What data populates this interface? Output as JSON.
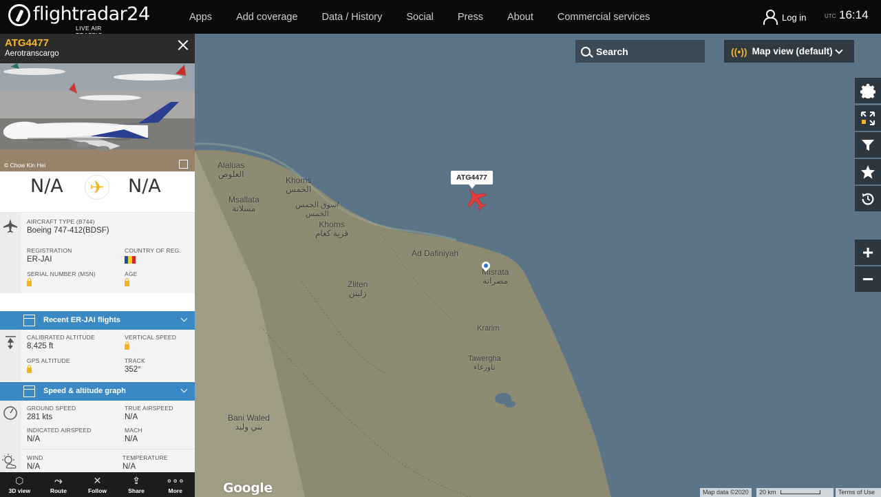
{
  "topbar": {
    "brand": "flightradar24",
    "tagline": "LIVE AIR TRAFFIC",
    "nav": [
      "Apps",
      "Add coverage",
      "Data / History",
      "Social",
      "Press",
      "About",
      "Commercial services"
    ],
    "login_label": "Log in",
    "utc_label": "UTC",
    "time": "16:14"
  },
  "map": {
    "search_label": "Search",
    "map_view_label": "Map view (default)",
    "flight_label": "ATG4477",
    "zoom_in": "+",
    "zoom_out": "−",
    "labels": {
      "alaluas": "Alaluas",
      "alaluas_ar": "العلوص",
      "khoms1": "Khoms",
      "khoms1_ar": "الخمس",
      "msallata": "Msallata",
      "msallata_ar": "مسلاتة",
      "souq_ar": "سوق الخمس/",
      "souq_ar2": "الخمس",
      "khoms2": "Khoms",
      "khoms2_ar": "قرية كعام",
      "dafiniyah": "Ad Dafiniyah",
      "zliten": "Zliten",
      "zliten_ar": "زليتن",
      "misrata": "Misrata",
      "misrata_ar": "مصراتة",
      "krarim": "Krarim",
      "tawergha": "Tawergha",
      "tawergha_ar": "تاورغاء",
      "baniwaled": "Bani Waled",
      "baniwaled_ar": "بني وليد"
    },
    "google": "Google",
    "map_data": "Map data ©2020",
    "scale": "20 km",
    "terms": "Terms of Use"
  },
  "panel": {
    "callsign": "ATG4477",
    "airline": "Aerotranscargo",
    "photo_credit": "© Chow Kin Hei",
    "origin": "N/A",
    "destination": "N/A",
    "aircraft_type_label": "AIRCRAFT TYPE",
    "aircraft_type_code": "(B744)",
    "aircraft_type": "Boeing 747-412(BDSF)",
    "registration_label": "REGISTRATION",
    "registration": "ER-JAI",
    "country_label": "COUNTRY OF REG.",
    "serial_label": "SERIAL NUMBER (MSN)",
    "age_label": "AGE",
    "recent_flights": "Recent ER-JAI flights",
    "calibrated_alt_label": "CALIBRATED ALTITUDE",
    "calibrated_alt": "8,425 ft",
    "vertical_speed_label": "VERTICAL SPEED",
    "gps_alt_label": "GPS ALTITUDE",
    "track_label": "TRACK",
    "track": "352°",
    "speed_graph": "Speed & altitude graph",
    "ground_speed_label": "GROUND SPEED",
    "ground_speed": "281 kts",
    "true_airspeed_label": "TRUE AIRSPEED",
    "true_airspeed": "N/A",
    "indicated_airspeed_label": "INDICATED AIRSPEED",
    "indicated_airspeed": "N/A",
    "mach_label": "MACH",
    "mach": "N/A",
    "wind_label": "WIND",
    "wind": "N/A",
    "temperature_label": "TEMPERATURE",
    "temperature": "N/A"
  },
  "bottombar": [
    "3D view",
    "Route",
    "Follow",
    "Share",
    "More"
  ]
}
